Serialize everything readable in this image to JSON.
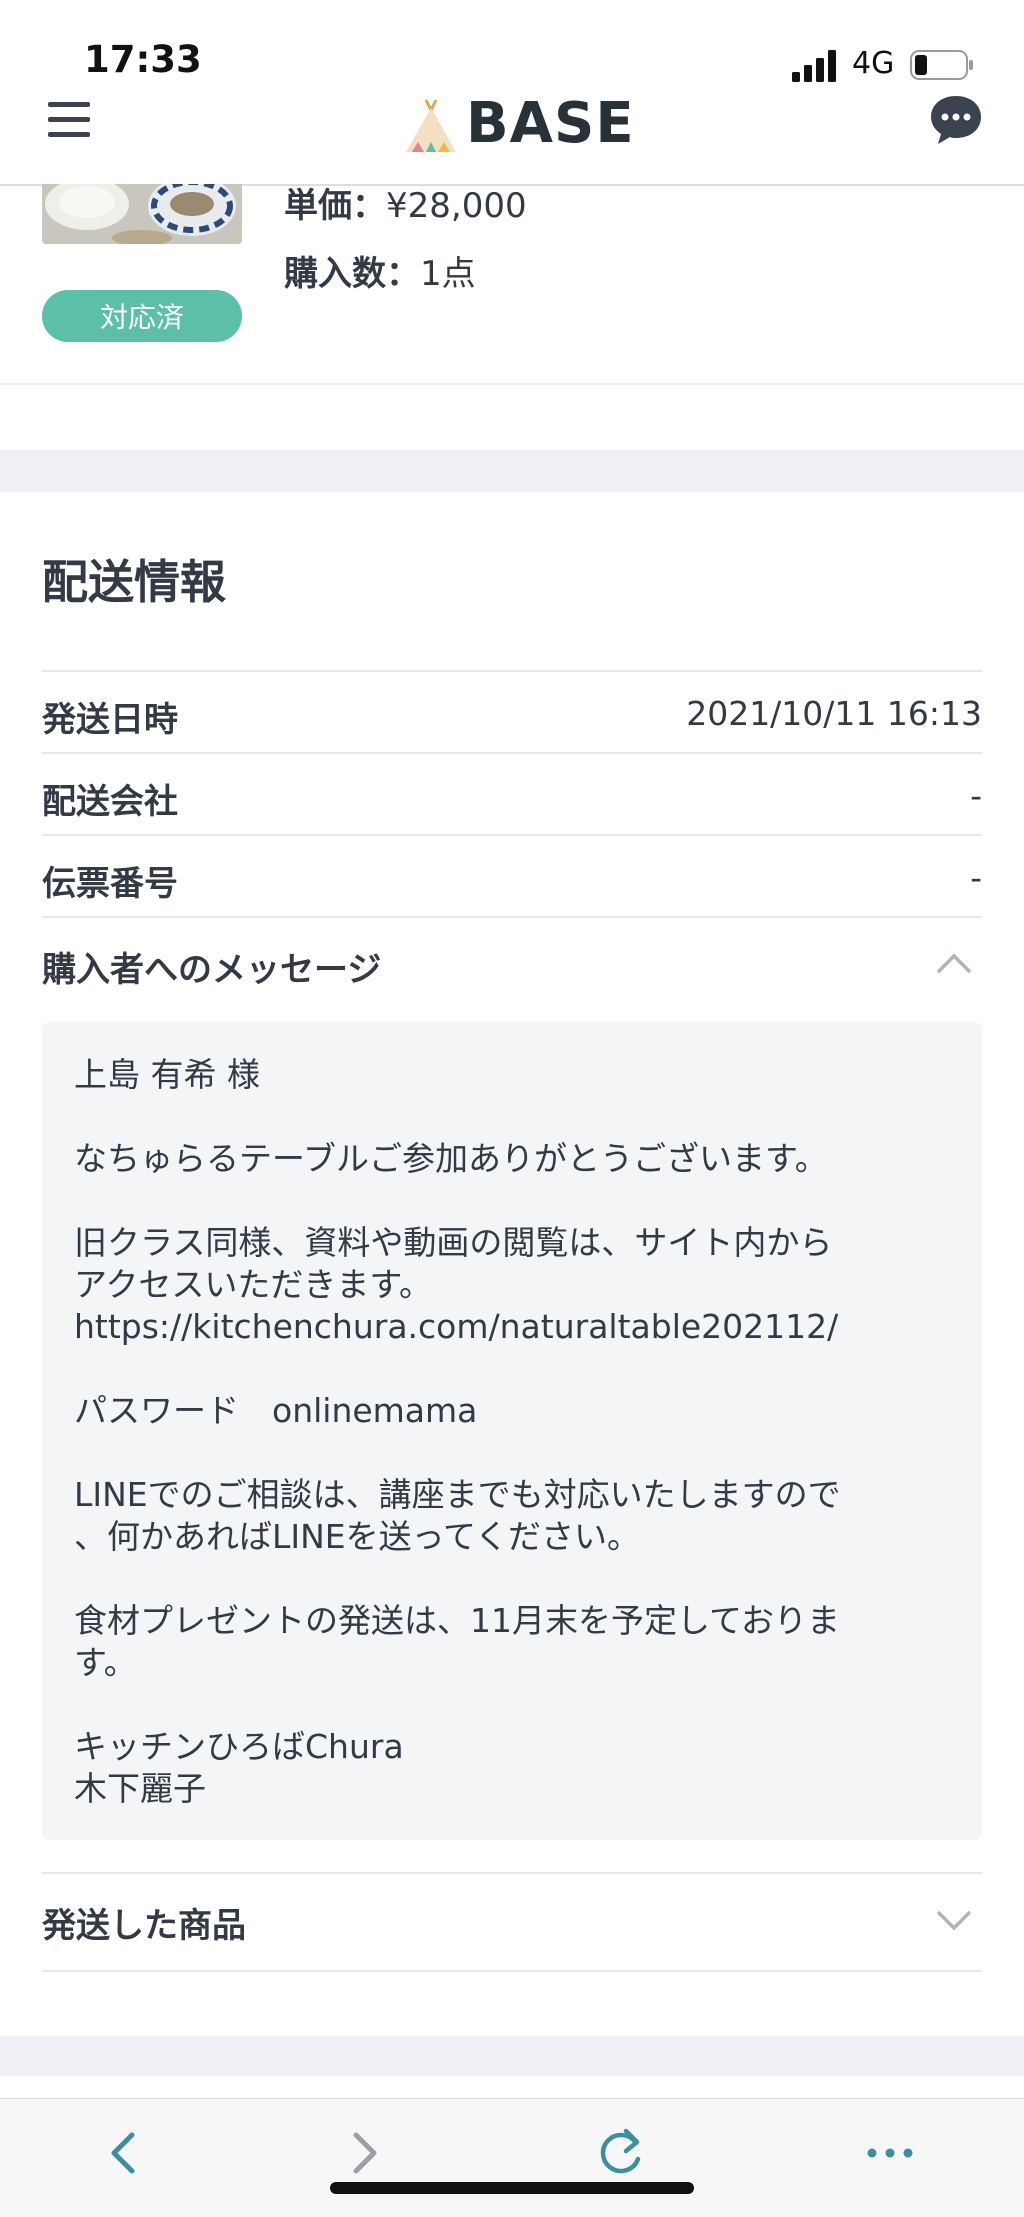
{
  "status_bar": {
    "time": "17:33",
    "network": "4G"
  },
  "header": {
    "logo_text": "BASE"
  },
  "product": {
    "status_badge": "対応済",
    "price_label": "単価：",
    "price_value": "¥28,000",
    "qty_label": "購入数：",
    "qty_value": "1点"
  },
  "shipping": {
    "title": "配送情報",
    "rows": [
      {
        "label": "発送日時",
        "value": "2021/10/11 16:13"
      },
      {
        "label": "配送会社",
        "value": "-"
      },
      {
        "label": "伝票番号",
        "value": "-"
      }
    ],
    "message_header": "購入者へのメッセージ",
    "message_lines": [
      "上島 有希 様",
      "なちゅらるテーブルご参加ありがとうございます。",
      "旧クラス同様、資料や動画の閲覧は、サイト内から",
      "アクセスいただきます。",
      "https://kitchenchura.com/naturaltable202112/",
      "パスワード　onlinemama",
      "LINEでのご相談は、講座までも対応いたしますので",
      "、何かあればLINEを送ってください。",
      "食材プレゼントの発送は、11月末を予定しておりま",
      "す。",
      "キッチンひろばChura",
      "木下麗子"
    ],
    "shipped_items_header": "発送した商品"
  },
  "icons": {
    "hamburger": "hamburger-menu-icon",
    "chat": "chat-bubble-icon",
    "back": "back-arrow-icon",
    "forward": "forward-arrow-icon",
    "reload": "reload-icon",
    "more": "more-dots-icon"
  },
  "colors": {
    "badge": "#5cbfa8",
    "accent": "#263238"
  }
}
